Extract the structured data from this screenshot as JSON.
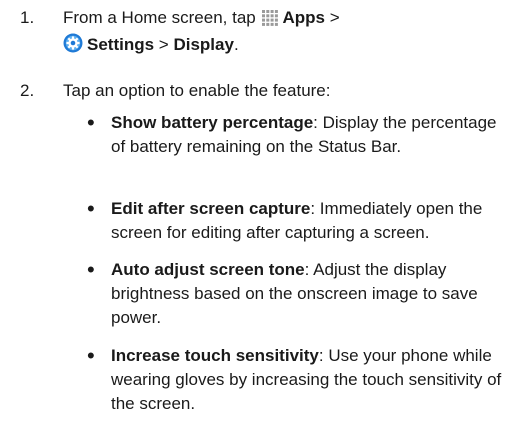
{
  "steps": [
    {
      "number": "1.",
      "prefix": "From a Home screen, tap",
      "apps_label": "Apps",
      "sep1": ">",
      "settings_label": "Settings",
      "sep2": ">",
      "display_label": "Display",
      "end": "."
    },
    {
      "number": "2.",
      "text": "Tap an option to enable the feature:"
    }
  ],
  "options": [
    {
      "title": "Show battery percentage",
      "description": ": Display the percentage of battery remaining on the Status Bar."
    },
    {
      "title": "Edit after screen capture",
      "description": ": Immediately open the screen for editing after capturing a screen."
    },
    {
      "title": "Auto adjust screen tone",
      "description": ": Adjust the display brightness based on the onscreen image to save power."
    },
    {
      "title": "Increase touch sensitivity",
      "description": ": Use your phone while wearing gloves by increasing the touch sensitivity of the screen."
    }
  ],
  "bullet_char": "•",
  "icons": {
    "apps": "apps-grid-icon",
    "settings": "settings-gear-icon"
  },
  "colors": {
    "text": "#1a1a1a",
    "apps_icon": "#9a9a9a",
    "settings_icon_blue": "#1f7ad6"
  }
}
